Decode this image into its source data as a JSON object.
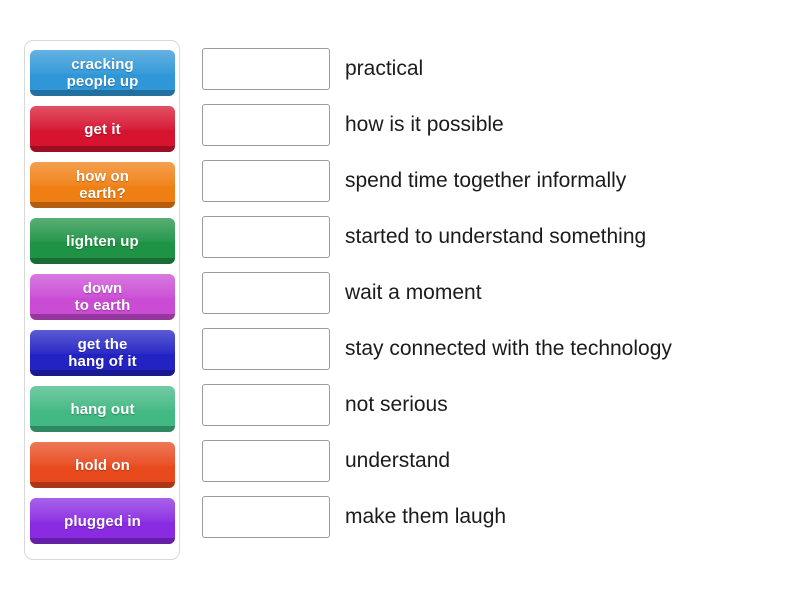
{
  "activity": {
    "type": "match-up",
    "background_color": "#ffffff"
  },
  "tile_bank": {
    "border_color": "#d8d8d8",
    "tiles": [
      {
        "label": "cracking\npeople up",
        "color": "#2f97d8"
      },
      {
        "label": "get it",
        "color": "#d6142f"
      },
      {
        "label": "how on\nearth?",
        "color": "#f07f13"
      },
      {
        "label": "lighten up",
        "color": "#1f9345"
      },
      {
        "label": "down\nto earth",
        "color": "#ca4bd4"
      },
      {
        "label": "get the\nhang of it",
        "color": "#2323c4"
      },
      {
        "label": "hang out",
        "color": "#42b883"
      },
      {
        "label": "hold on",
        "color": "#e8491d"
      },
      {
        "label": "plugged in",
        "color": "#8a2be2"
      }
    ]
  },
  "answers": {
    "box_placeholder": "",
    "rows": [
      {
        "box_value": "",
        "text": "practical"
      },
      {
        "box_value": "",
        "text": "how is it possible"
      },
      {
        "box_value": "",
        "text": "spend time together informally"
      },
      {
        "box_value": "",
        "text": "started to understand something"
      },
      {
        "box_value": "",
        "text": "wait a moment"
      },
      {
        "box_value": "",
        "text": "stay connected with the technology"
      },
      {
        "box_value": "",
        "text": "not serious"
      },
      {
        "box_value": "",
        "text": "understand"
      },
      {
        "box_value": "",
        "text": "make them laugh"
      }
    ]
  }
}
